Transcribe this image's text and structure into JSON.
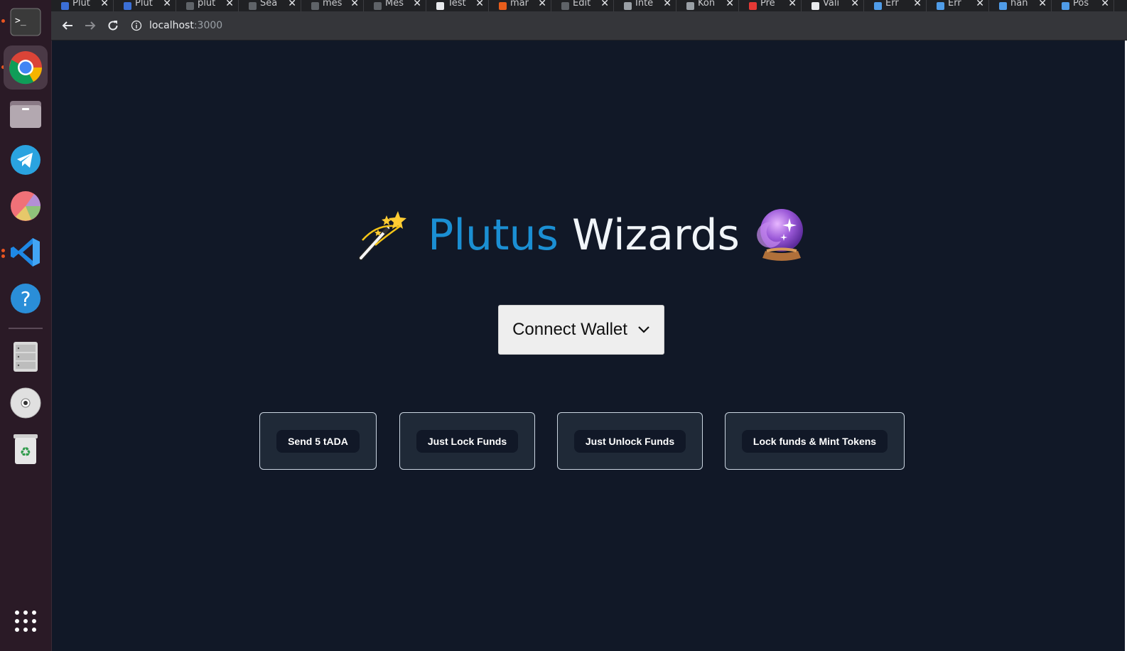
{
  "browser": {
    "tabs": [
      {
        "title": "Plut",
        "favicon_color": "#3b6fd6"
      },
      {
        "title": "Plut",
        "favicon_color": "#3b6fd6"
      },
      {
        "title": "plut",
        "favicon_color": "#5f6368"
      },
      {
        "title": "Sea",
        "favicon_color": "#5f6368"
      },
      {
        "title": "mes",
        "favicon_color": "#5f6368"
      },
      {
        "title": "Mes",
        "favicon_color": "#5f6368"
      },
      {
        "title": "Test",
        "favicon_color": "#e8eaed"
      },
      {
        "title": "mar",
        "favicon_color": "#e85d1b"
      },
      {
        "title": "Edit",
        "favicon_color": "#5f6368"
      },
      {
        "title": "Inte",
        "favicon_color": "#9aa0a6"
      },
      {
        "title": "Kon",
        "favicon_color": "#9aa0a6"
      },
      {
        "title": "Pre",
        "favicon_color": "#e53935"
      },
      {
        "title": "Vali",
        "favicon_color": "#e8eaed"
      },
      {
        "title": "Err",
        "favicon_color": "#4f9ce8"
      },
      {
        "title": "Err",
        "favicon_color": "#4f9ce8"
      },
      {
        "title": "han",
        "favicon_color": "#4f9ce8"
      },
      {
        "title": "Pos",
        "favicon_color": "#4f9ce8"
      }
    ],
    "tab_close": "✕",
    "url_host": "localhost",
    "url_port": ":3000"
  },
  "dock": {
    "items": [
      "terminal-icon",
      "chrome-icon",
      "files-icon",
      "telegram-icon",
      "pie-chart-icon",
      "vscode-icon",
      "help-icon",
      "server-icon",
      "disc-icon",
      "trash-icon"
    ],
    "apps_grid": "apps-grid-icon"
  },
  "hero": {
    "title_part1": "Plutus",
    "title_part2": "Wizards",
    "left_emoji": "🪄",
    "right_emoji": "🔮",
    "title_colors": {
      "blue": "#1b8fd3",
      "white": "#f1f5f9"
    }
  },
  "wallet": {
    "connect_label": "Connect Wallet"
  },
  "actions": [
    {
      "label": "Send 5 tADA"
    },
    {
      "label": "Just Lock Funds"
    },
    {
      "label": "Just Unlock Funds"
    },
    {
      "label": "Lock funds & Mint Tokens"
    }
  ],
  "colors": {
    "page_bg": "#111827",
    "card_bg": "#1f2937",
    "card_border": "#cbd5e1"
  }
}
